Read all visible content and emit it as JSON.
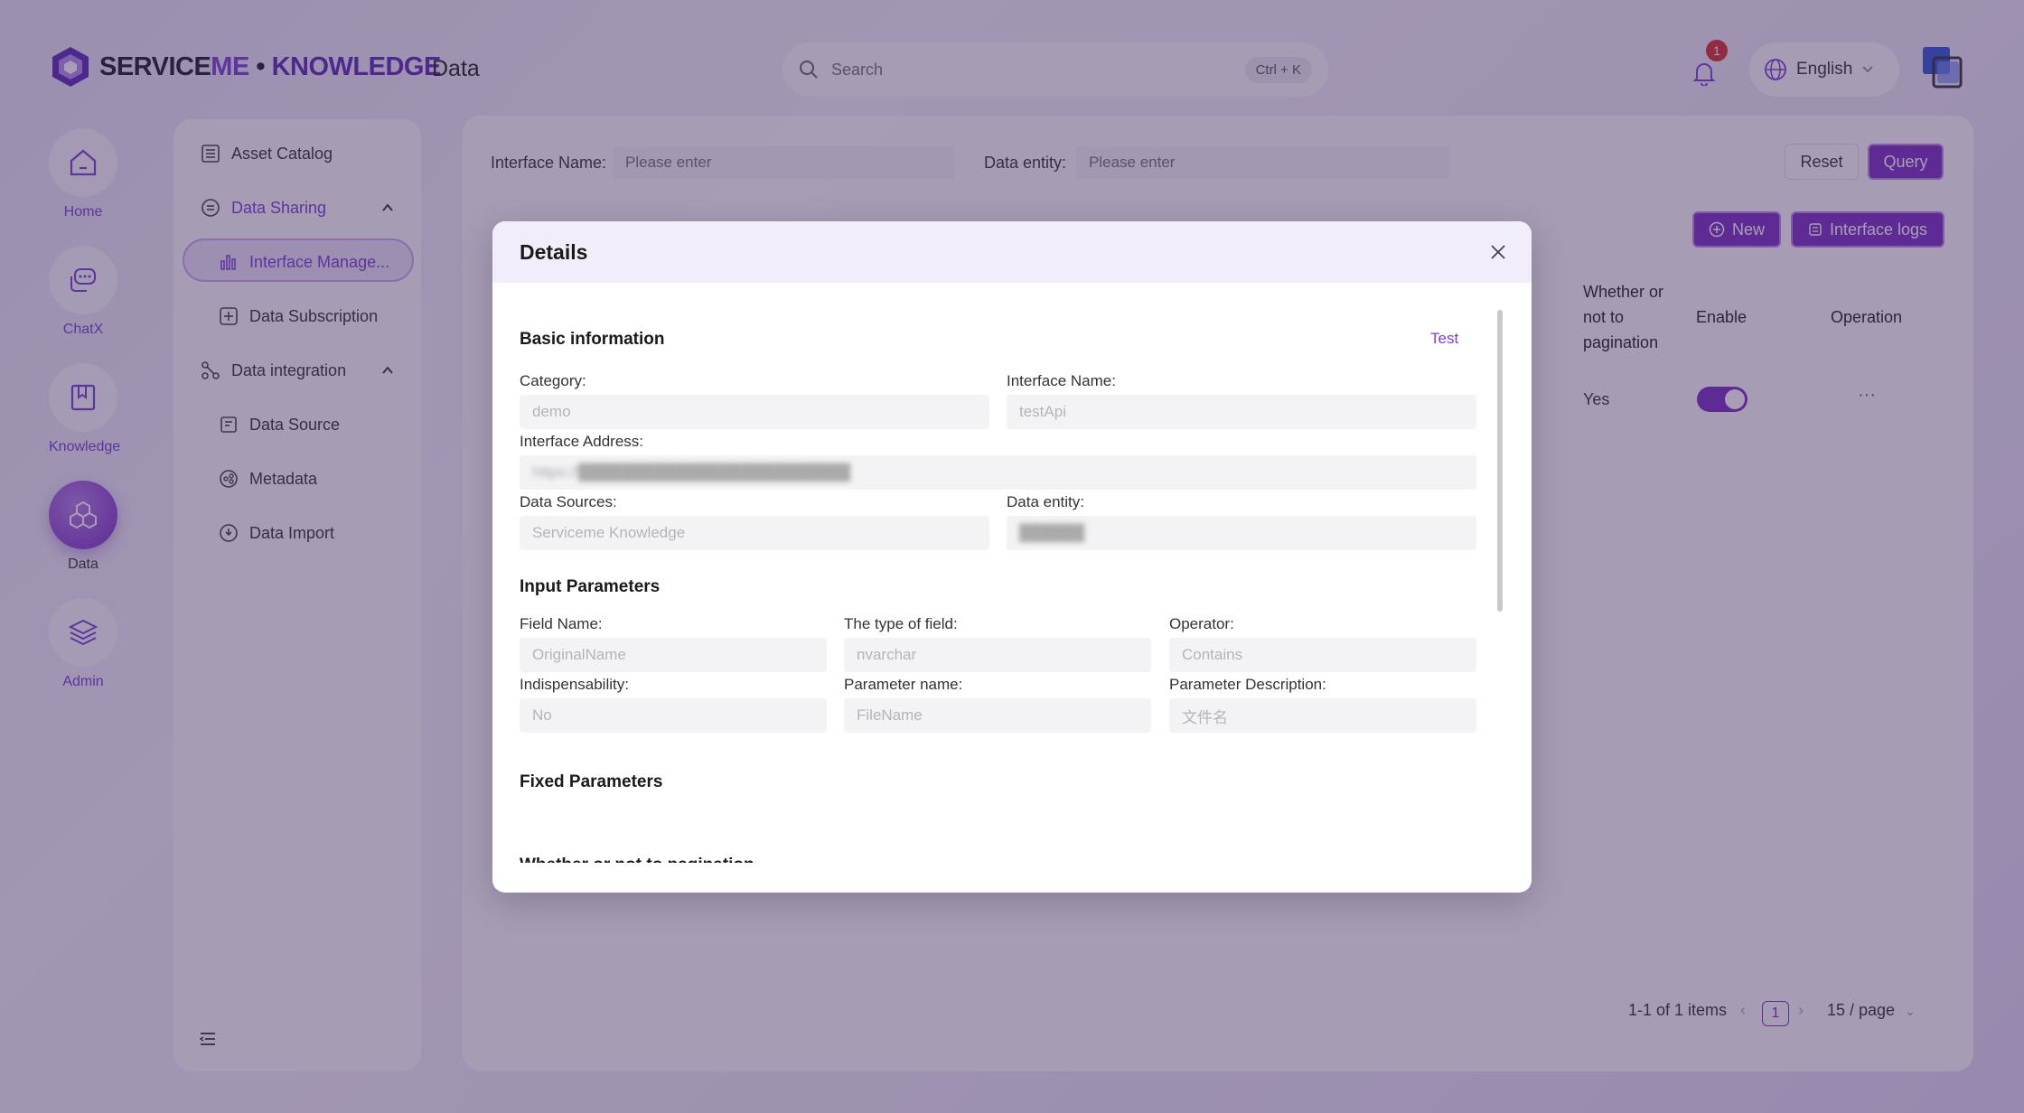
{
  "app": {
    "logo_part1": "SERVICE",
    "logo_part2": "ME",
    "logo_dot": "•",
    "logo_part3": "KNOWLEDGE",
    "page_title": "Data"
  },
  "search": {
    "placeholder": "Search",
    "shortcut": "Ctrl + K"
  },
  "notifications": {
    "count": "1"
  },
  "language": {
    "label": "English"
  },
  "rail": [
    {
      "label": "Home",
      "icon": "home-icon"
    },
    {
      "label": "ChatX",
      "icon": "chat-icon"
    },
    {
      "label": "Knowledge",
      "icon": "book-icon"
    },
    {
      "label": "Data",
      "icon": "hexagon-icon"
    },
    {
      "label": "Admin",
      "icon": "layers-icon"
    }
  ],
  "sidebar": {
    "items": [
      {
        "label": "Asset Catalog"
      },
      {
        "label": "Data Sharing"
      },
      {
        "label": "Interface Manage..."
      },
      {
        "label": "Data Subscription"
      },
      {
        "label": "Data integration"
      },
      {
        "label": "Data Source"
      },
      {
        "label": "Metadata"
      },
      {
        "label": "Data Import"
      }
    ]
  },
  "filters": {
    "interface_name_label": "Interface Name:",
    "interface_name_placeholder": "Please enter",
    "data_entity_label": "Data entity:",
    "data_entity_placeholder": "Please enter",
    "reset": "Reset",
    "query": "Query"
  },
  "toolbar": {
    "new": "New",
    "interface_logs": "Interface logs"
  },
  "table": {
    "headers": {
      "pagination": [
        "Whether or",
        "not to",
        "pagination"
      ],
      "enable": "Enable",
      "operation": "Operation"
    },
    "rows": [
      {
        "pagination": "Yes",
        "enable": true,
        "operation": "···"
      }
    ]
  },
  "pagination": {
    "summary": "1-1 of 1 items",
    "current": "1",
    "page_size": "15 / page"
  },
  "modal": {
    "title": "Details",
    "basic_title": "Basic information",
    "test_link": "Test",
    "category_label": "Category:",
    "category_value": "demo",
    "interface_name_label": "Interface Name:",
    "interface_name_value": "testApi",
    "address_label": "Interface Address:",
    "address_value": "https://█████████████████████████",
    "data_sources_label": "Data Sources:",
    "data_sources_value": "Serviceme Knowledge",
    "data_entity_label": "Data entity:",
    "data_entity_value": "██████",
    "input_title": "Input Parameters",
    "field_name_label": "Field Name:",
    "field_name_value": "OriginalName",
    "field_type_label": "The type of field:",
    "field_type_value": "nvarchar",
    "operator_label": "Operator:",
    "operator_value": "Contains",
    "indisp_label": "Indispensability:",
    "indisp_value": "No",
    "param_name_label": "Parameter name:",
    "param_name_value": "FileName",
    "param_desc_label": "Parameter Description:",
    "param_desc_value": "文件名",
    "fixed_title": "Fixed Parameters",
    "cut_title": "Whether or not to pagination"
  }
}
